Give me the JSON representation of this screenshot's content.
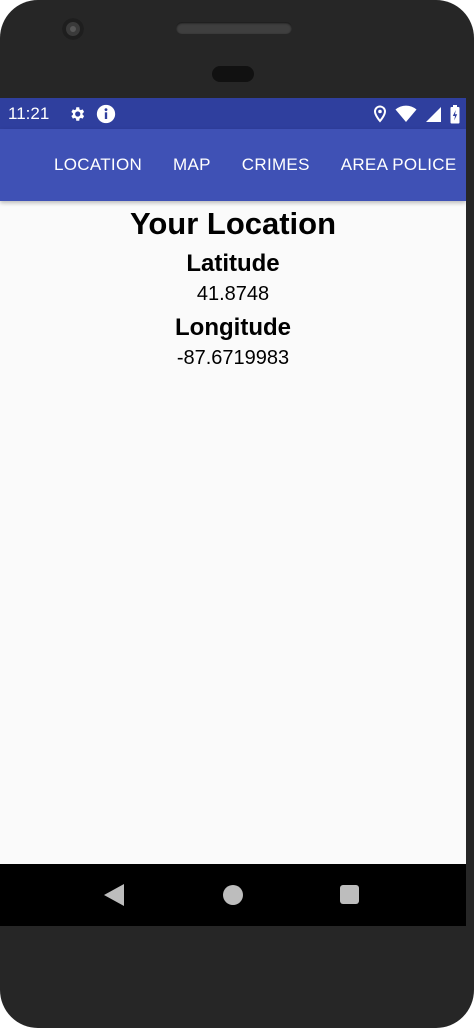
{
  "status_bar": {
    "time": "11:21",
    "left_icons": [
      "gear-icon",
      "info-icon"
    ],
    "right_icons": [
      "location-pin-icon",
      "wifi-icon",
      "cell-signal-icon",
      "battery-icon"
    ],
    "color": "#2f3f9e"
  },
  "app_bar": {
    "color": "#3f51b5",
    "tabs": [
      {
        "label": "LOCATION"
      },
      {
        "label": "MAP"
      },
      {
        "label": "CRIMES"
      },
      {
        "label": "AREA POLICE"
      }
    ]
  },
  "location": {
    "title": "Your Location",
    "latitude_label": "Latitude",
    "latitude_value": "41.8748",
    "longitude_label": "Longitude",
    "longitude_value": "-87.6719983"
  },
  "nav_bar": {
    "buttons": [
      "back-icon",
      "home-icon",
      "recents-icon"
    ]
  }
}
